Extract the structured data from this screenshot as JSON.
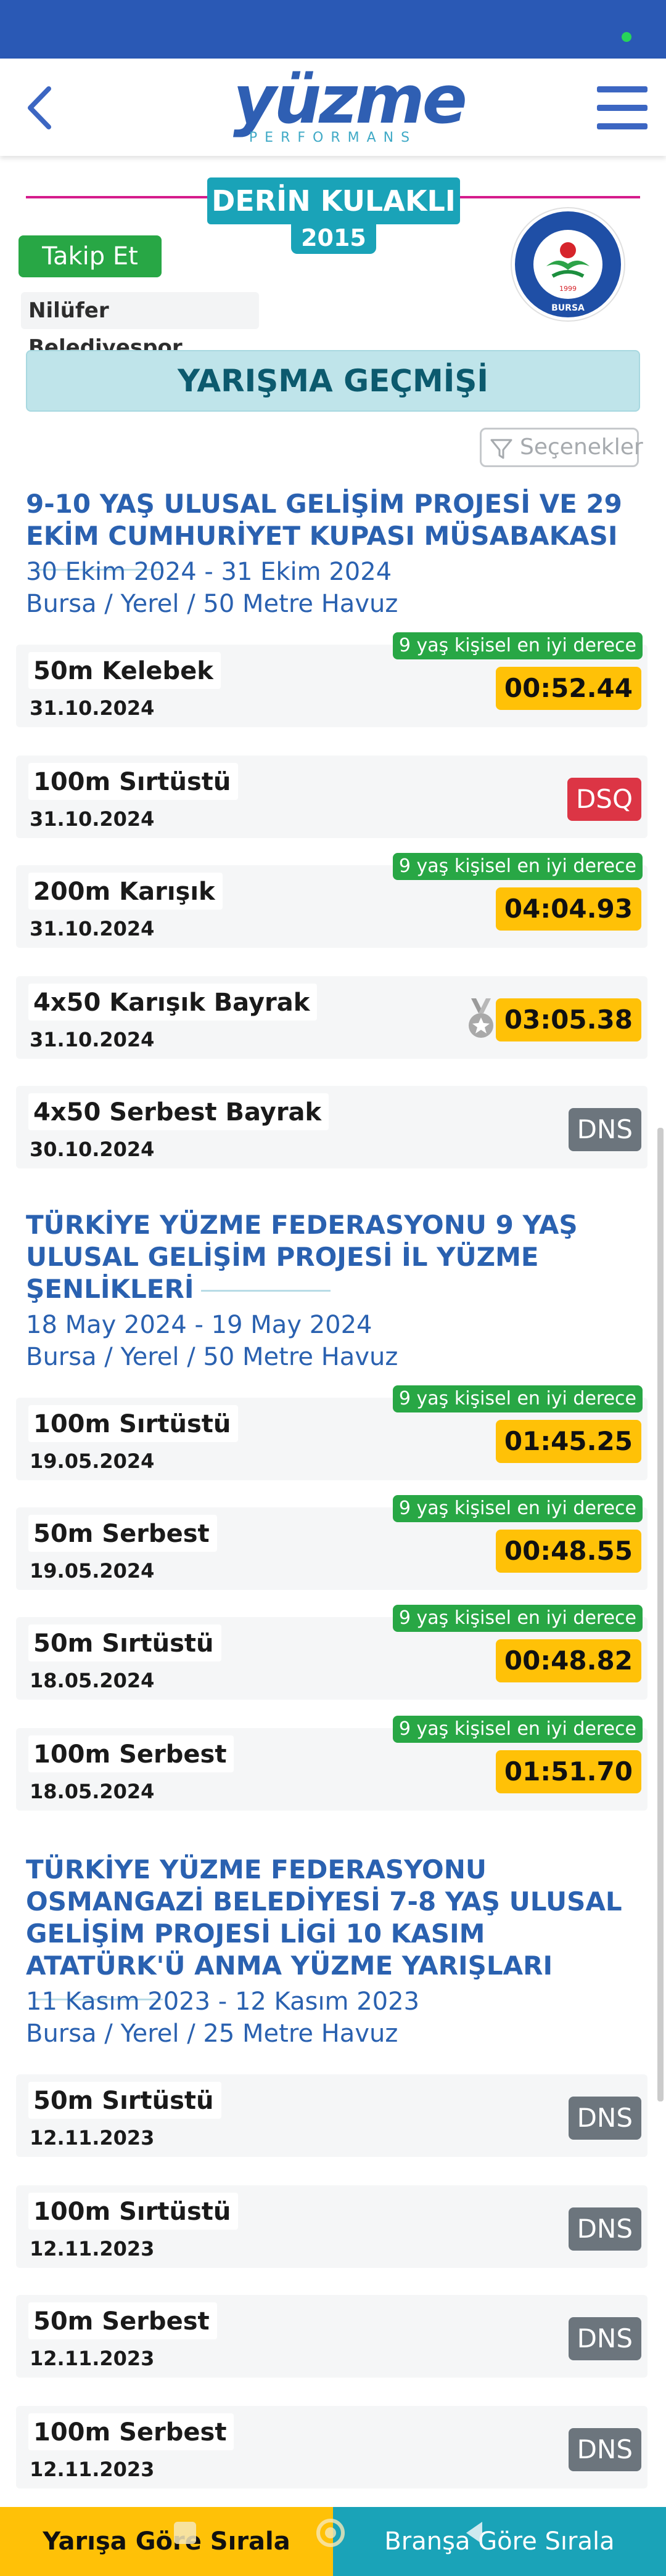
{
  "app": {
    "logo_text": "yüzme",
    "logo_sub": "PERFORMANS"
  },
  "athlete": {
    "name": "DERİN KULAKLI",
    "birth_year": "2015",
    "follow_label": "Takip Et",
    "club": "Nilüfer Belediyespor",
    "club_logo_text_top": "NİLÜFER BELEDİYESPOR",
    "club_logo_year": "1999",
    "club_logo_text_bottom": "BURSA"
  },
  "section_title": "YARIŞMA GEÇMİŞİ",
  "options_label": "Seçenekler",
  "competitions": [
    {
      "title": "9-10 YAŞ ULUSAL GELİŞİM PROJESİ VE 29 EKİM CUMHURİYET KUPASI MÜSABAKASI",
      "dates": "30 Ekim 2024 - 31 Ekim 2024",
      "place": "Bursa / Yerel / 50 Metre Havuz",
      "results": [
        {
          "event": "50m Kelebek",
          "date": "31.10.2024",
          "result": "00:52.44",
          "status": "time",
          "pb": "9 yaş kişisel en iyi derece"
        },
        {
          "event": "100m Sırtüstü",
          "date": "31.10.2024",
          "result": "DSQ",
          "status": "dsq",
          "pb": ""
        },
        {
          "event": "200m Karışık",
          "date": "31.10.2024",
          "result": "04:04.93",
          "status": "time",
          "pb": "9 yaş kişisel en iyi derece"
        },
        {
          "event": "4x50 Karışık Bayrak",
          "date": "31.10.2024",
          "result": "03:05.38",
          "status": "time",
          "pb": "",
          "medal": "silver"
        },
        {
          "event": "4x50 Serbest Bayrak",
          "date": "30.10.2024",
          "result": "DNS",
          "status": "dns",
          "pb": ""
        }
      ]
    },
    {
      "title": "TÜRKİYE YÜZME FEDERASYONU 9 YAŞ ULUSAL GELİŞİM PROJESİ İL YÜZME ŞENLİKLERİ",
      "dates": "18 May 2024 - 19 May 2024",
      "place": "Bursa / Yerel / 50 Metre Havuz",
      "results": [
        {
          "event": "100m Sırtüstü",
          "date": "19.05.2024",
          "result": "01:45.25",
          "status": "time",
          "pb": "9 yaş kişisel en iyi derece"
        },
        {
          "event": "50m Serbest",
          "date": "19.05.2024",
          "result": "00:48.55",
          "status": "time",
          "pb": "9 yaş kişisel en iyi derece"
        },
        {
          "event": "50m Sırtüstü",
          "date": "18.05.2024",
          "result": "00:48.82",
          "status": "time",
          "pb": "9 yaş kişisel en iyi derece"
        },
        {
          "event": "100m Serbest",
          "date": "18.05.2024",
          "result": "01:51.70",
          "status": "time",
          "pb": "9 yaş kişisel en iyi derece"
        }
      ]
    },
    {
      "title": "TÜRKİYE YÜZME FEDERASYONU OSMANGAZİ BELEDİYESİ 7-8 YAŞ ULUSAL GELİŞİM PROJESİ LİGİ 10 KASIM ATATÜRK'Ü ANMA YÜZME YARIŞLARI",
      "dates": "11 Kasım 2023 - 12 Kasım 2023",
      "place": "Bursa / Yerel / 25 Metre Havuz",
      "results": [
        {
          "event": "50m Sırtüstü",
          "date": "12.11.2023",
          "result": "DNS",
          "status": "dns",
          "pb": ""
        },
        {
          "event": "100m Sırtüstü",
          "date": "12.11.2023",
          "result": "DNS",
          "status": "dns",
          "pb": ""
        },
        {
          "event": "50m Serbest",
          "date": "12.11.2023",
          "result": "DNS",
          "status": "dns",
          "pb": ""
        },
        {
          "event": "100m Serbest",
          "date": "12.11.2023",
          "result": "DNS",
          "status": "dns",
          "pb": ""
        }
      ]
    }
  ],
  "bottom": {
    "sort_race": "Yarışa Göre Sırala",
    "sort_branch": "Branşa Göre Sırala"
  },
  "colors": {
    "brand_blue": "#2a59b5",
    "teal": "#1aa3b8",
    "time_yellow": "#ffc107",
    "pb_green": "#28a745",
    "dsq_red": "#dc3545",
    "dns_gray": "#6c757d",
    "accent_pink": "#d51b8c"
  }
}
